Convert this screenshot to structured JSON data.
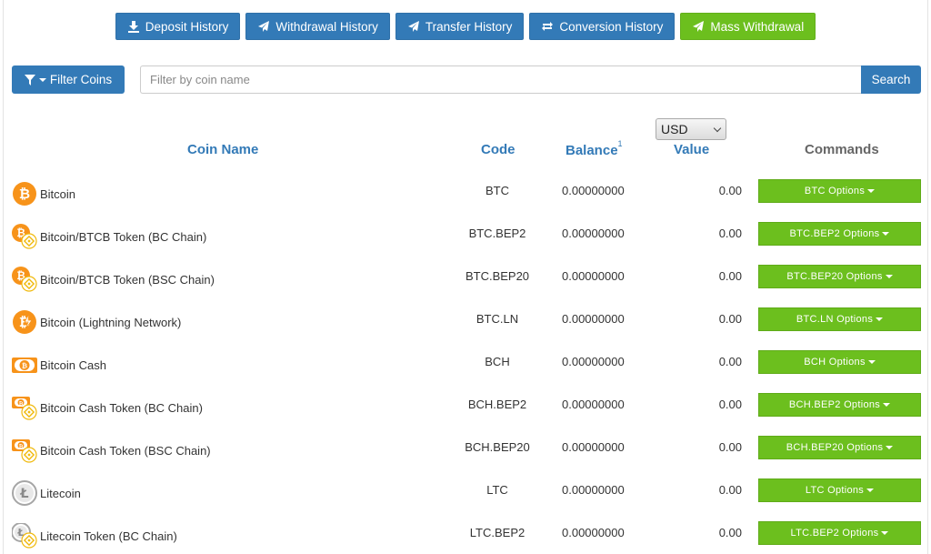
{
  "toolbar": {
    "deposit_history": "Deposit History",
    "withdrawal_history": "Withdrawal History",
    "transfer_history": "Transfer History",
    "conversion_history": "Conversion History",
    "mass_withdrawal": "Mass Withdrawal"
  },
  "filter": {
    "button_label": "Filter Coins",
    "placeholder": "Filter by coin name",
    "search_label": "Search"
  },
  "currency": {
    "selected": "USD"
  },
  "table": {
    "headers": {
      "coin_name": "Coin Name",
      "code": "Code",
      "balance": "Balance",
      "balance_footnote": "1",
      "value": "Value",
      "commands": "Commands"
    },
    "rows": [
      {
        "name": "Bitcoin",
        "code": "BTC",
        "balance": "0.00000000",
        "value": "0.00",
        "options": "BTC Options",
        "icon": "bitcoin-icon"
      },
      {
        "name": "Bitcoin/BTCB Token (BC Chain)",
        "code": "BTC.BEP2",
        "balance": "0.00000000",
        "value": "0.00",
        "options": "BTC.BEP2 Options",
        "icon": "bitcoin-bnb-icon"
      },
      {
        "name": "Bitcoin/BTCB Token (BSC Chain)",
        "code": "BTC.BEP20",
        "balance": "0.00000000",
        "value": "0.00",
        "options": "BTC.BEP20 Options",
        "icon": "bitcoin-bnb-icon"
      },
      {
        "name": "Bitcoin (Lightning Network)",
        "code": "BTC.LN",
        "balance": "0.00000000",
        "value": "0.00",
        "options": "BTC.LN Options",
        "icon": "bitcoin-lightning-icon"
      },
      {
        "name": "Bitcoin Cash",
        "code": "BCH",
        "balance": "0.00000000",
        "value": "0.00",
        "options": "BCH Options",
        "icon": "bitcoin-cash-icon"
      },
      {
        "name": "Bitcoin Cash Token (BC Chain)",
        "code": "BCH.BEP2",
        "balance": "0.00000000",
        "value": "0.00",
        "options": "BCH.BEP2 Options",
        "icon": "bitcoin-cash-bnb-icon"
      },
      {
        "name": "Bitcoin Cash Token (BSC Chain)",
        "code": "BCH.BEP20",
        "balance": "0.00000000",
        "value": "0.00",
        "options": "BCH.BEP20 Options",
        "icon": "bitcoin-cash-bnb-icon"
      },
      {
        "name": "Litecoin",
        "code": "LTC",
        "balance": "0.00000000",
        "value": "0.00",
        "options": "LTC Options",
        "icon": "litecoin-icon"
      },
      {
        "name": "Litecoin Token (BC Chain)",
        "code": "LTC.BEP2",
        "balance": "0.00000000",
        "value": "0.00",
        "options": "LTC.BEP2 Options",
        "icon": "litecoin-bnb-icon"
      }
    ]
  },
  "colors": {
    "primary": "#337ab7",
    "success": "#6cbf1e",
    "bitcoin": "#f7931a",
    "bnb": "#f0b90b",
    "litecoin": "#a6a6a6"
  }
}
